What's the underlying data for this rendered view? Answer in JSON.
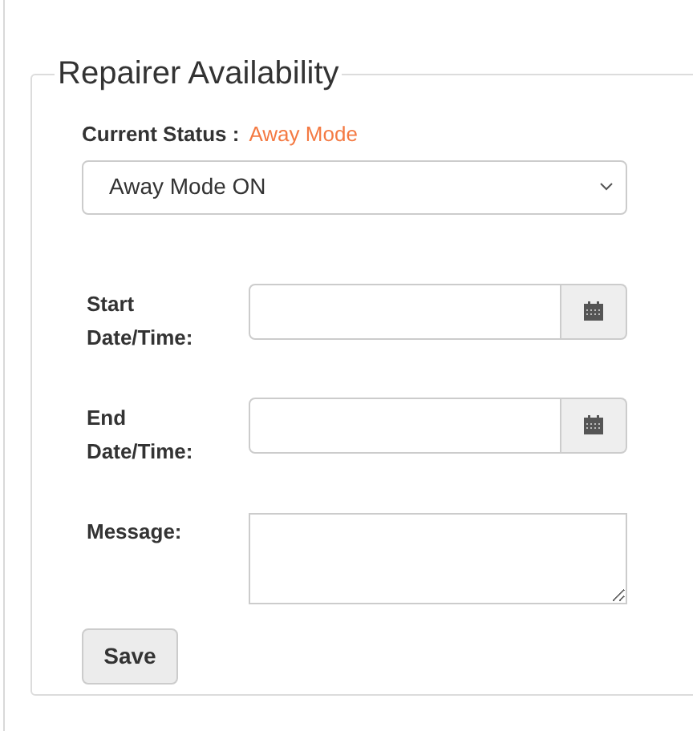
{
  "panel": {
    "title": "Repairer Availability"
  },
  "status": {
    "label": "Current Status :",
    "value": "Away Mode",
    "color": "#f47a43"
  },
  "mode_select": {
    "value": "Away Mode ON"
  },
  "fields": [
    {
      "kind": "date",
      "label_lines": [
        "Start",
        "Date/Time:"
      ]
    },
    {
      "kind": "date",
      "label_lines": [
        "End",
        "Date/Time:"
      ]
    },
    {
      "kind": "textarea",
      "label_lines": [
        "Message:"
      ]
    }
  ],
  "buttons": [
    "Save"
  ]
}
